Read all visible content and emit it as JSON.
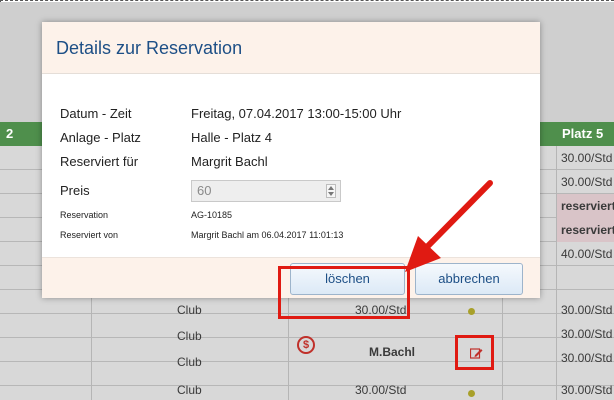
{
  "background": {
    "header_left": "2",
    "header_right": "Platz 5",
    "platz5_values": [
      "30.00/Std",
      "30.00/Std",
      "reserviert",
      "reserviert",
      "40.00/Std",
      "30.00/Std",
      "30.00/Std",
      "30.00/Std",
      "30.00/Std"
    ],
    "club_label": "Club",
    "price_under_footer": "30.00/Std",
    "booked_by": "M.Bachl",
    "price_last_row": "30.00/Std"
  },
  "modal": {
    "title": "Details zur Reservation",
    "rows": {
      "datum_label": "Datum - Zeit",
      "datum_value": "Freitag, 07.04.2017 13:00-15:00 Uhr",
      "anlage_label": "Anlage - Platz",
      "anlage_value": "Halle - Platz 4",
      "reserviert_fuer_label": "Reserviert für",
      "reserviert_fuer_value": "Margrit Bachl",
      "preis_label": "Preis",
      "preis_value": "60",
      "reservation_label": "Reservation",
      "reservation_value": "AG-10185",
      "reserviert_von_label": "Reserviert von",
      "reserviert_von_value": "Margrit Bachl am 06.04.2017 11:01:13"
    },
    "buttons": {
      "delete": "löschen",
      "cancel": "abbrechen"
    }
  },
  "icons": {
    "dollar": "$"
  },
  "colors": {
    "title": "#1d4f86",
    "header_green": "#4f8f4c",
    "annotation_red": "#e01a12"
  }
}
